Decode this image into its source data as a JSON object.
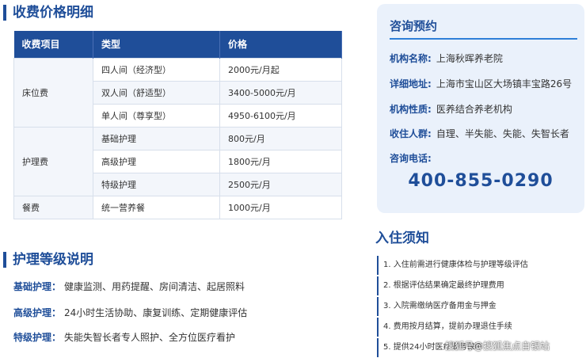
{
  "fee_section": {
    "title": "收费价格明细",
    "headers": [
      "收费项目",
      "类型",
      "价格"
    ],
    "groups": [
      {
        "category": "床位费",
        "items": [
          {
            "type": "四人间（经济型）",
            "price": "2000元/月起"
          },
          {
            "type": "双人间（舒适型）",
            "price": "3400-5000元/月"
          },
          {
            "type": "单人间（尊享型）",
            "price": "4950-6100元/月"
          }
        ]
      },
      {
        "category": "护理费",
        "items": [
          {
            "type": "基础护理",
            "price": "800元/月"
          },
          {
            "type": "高级护理",
            "price": "1800元/月"
          },
          {
            "type": "特级护理",
            "price": "2500元/月"
          }
        ]
      },
      {
        "category": "餐费",
        "items": [
          {
            "type": "统一营养餐",
            "price": "1000元/月"
          }
        ]
      }
    ]
  },
  "care_section": {
    "title": "护理等级说明",
    "levels": [
      {
        "label": "基础护理：",
        "text": "健康监测、用药提醒、房间清洁、起居照料"
      },
      {
        "label": "高级护理：",
        "text": "24小时生活协助、康复训练、定期健康评估"
      },
      {
        "label": "特级护理：",
        "text": "失能失智长者专人照护、全方位医疗看护"
      }
    ]
  },
  "consult_card": {
    "title": "咨询预约",
    "rows": [
      {
        "key": "机构名称:",
        "value": "上海秋晖养老院"
      },
      {
        "key": "详细地址:",
        "value": "上海市宝山区大场镇丰宝路26号"
      },
      {
        "key": "机构性质:",
        "value": "医养结合养老机构"
      },
      {
        "key": "收住人群:",
        "value": "自理、半失能、失能、失智长者"
      },
      {
        "key": "咨询电话:",
        "value": ""
      }
    ],
    "phone": "400-855-0290"
  },
  "notice_section": {
    "title": "入住须知",
    "items": [
      "1. 入住前需进行健康体检与护理等级评估",
      "2. 根据评估结果确定最终护理费用",
      "3. 入院需缴纳医疗备用金与押金",
      "4. 费用按月结算，提前办理退住手续",
      "5. 提供24小时医疗服务保障"
    ]
  },
  "watermark": "搜狐号@搜狐焦点自银站"
}
